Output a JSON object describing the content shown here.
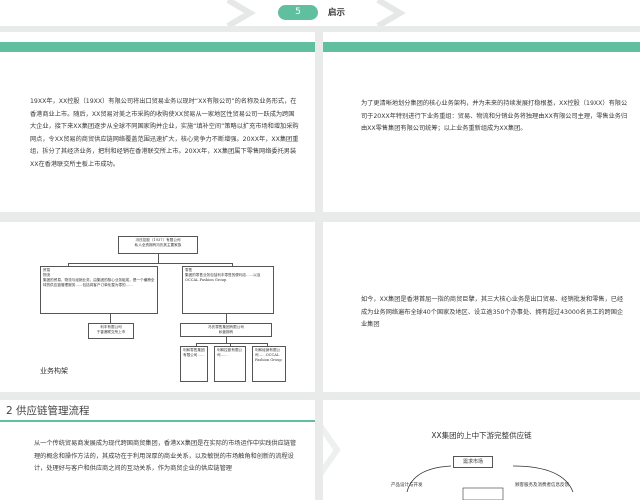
{
  "header": {
    "number": "5",
    "title": "启示"
  },
  "panels": {
    "p1_text": "19XX年，XX控股（19XX）有限公司将出口贸易业务以现时“XX有限公司”的名称及业务形式，在香港商业上市。随后，XX贸易对美之市采购的收购使XX贸易从一家地区性贸易公司一跃成为跨国大企业，接下来XX集团逐步从全球不同国家购并企业，实施“填补空间”策略以扩充市场和增加采购网点，令XX贸易的商贸供应链网络覆盖范围迅速扩大，核心竞争力不断增强。20XX年，XX集团重组，拆分了其经济业务，把利和经销在香港联交所上市。20XX年，XX集团属下零售网络委托男装XX在香港联交所主板上市成功。",
    "p2_text": "为了更清晰地划分集团的核心业务架构，并为未来的持续发展打稳根基，XX控股（19XX）有限公司于20XX年特别进行下业务重组：贸易、物流和分销业务将独理由XX有限公司主理，零售业务归由XX零售集团有限公司统筹；以上业务重新组成为XX集团。",
    "p4_text": "如今，XX集团是香港首屈一指的商贸巨擘，其三大核心业务是出口贸易、经销批发和零售，已经成为业务网络遍布全球40个国家及地区、设立逾350个办事处、拥有超过43000名员工的跨国企业集团"
  },
  "org": {
    "top": "冯氏控股（1937）有限公司\n私人全资拥有冯氏其主要家族",
    "left": "贸易\n物流\n集团的贸易、物流与经销业务，由集团的核心业务组成，是一个横跨全球的供应链管理服务……包括将客户订单化整为零的……",
    "right": "零售\n集团的零售业务包括利丰零售的便利店……以及OCCAL Fashion Group",
    "mid_left": "利丰有限公司\n于香港联交所上市",
    "mid_right": "冯氏零售集团有限公司\n私营拥有",
    "b1": "利和零售集团有限公司……",
    "b2": "利和控股有限公司……",
    "b3": "利和经销有限公司……OCCAL Fashion Group",
    "caption": "业务构架"
  },
  "section2": {
    "title": "2 供应链管理流程",
    "text": "从一个传统贸易商发展成为现代跨国商贸集团，香港XX集团是在实际的市场运作中实践供应链管理的概念和操作方法的，其成功在于利用深厚的商业关系，以及敏锐的市场触角和创新的流程设计，处理好与客户和供应商之间的互动关系，作为商贸企业的供应链管理"
  },
  "diagram": {
    "title": "XX集团的上中下游完整供应链",
    "n1": "需求市场",
    "n2": "产品设计与开发",
    "n3": "顾客服务及消费者信息反馈"
  }
}
